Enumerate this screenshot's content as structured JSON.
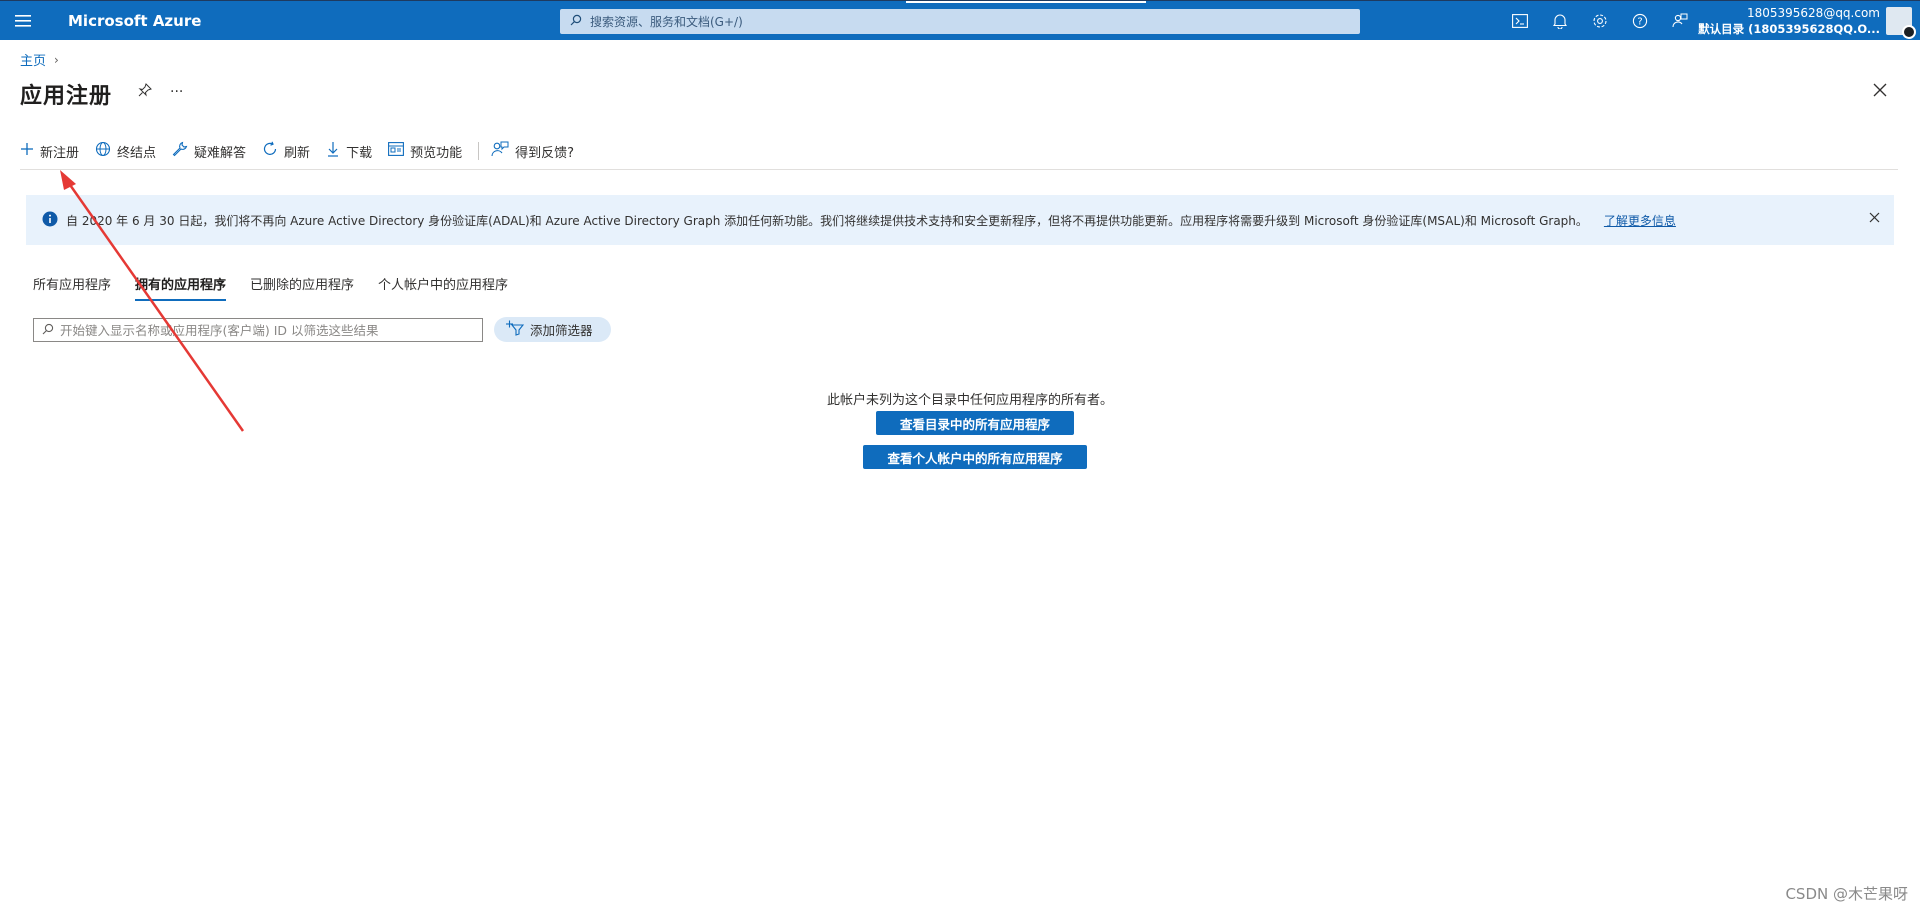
{
  "header": {
    "brand": "Microsoft Azure",
    "search_placeholder": "搜索资源、服务和文档(G+/)",
    "account_email": "1805395628@qq.com",
    "account_directory": "默认目录 (1805395628QQ.O...",
    "icons": [
      "cloud-shell-icon",
      "bell-icon",
      "gear-icon",
      "help-icon",
      "feedback-icon"
    ]
  },
  "breadcrumb": {
    "home": "主页",
    "separator": "›"
  },
  "page": {
    "title": "应用注册",
    "more": "···"
  },
  "toolbar": {
    "items": [
      {
        "label": "新注册",
        "icon": "plus-icon"
      },
      {
        "label": "终结点",
        "icon": "globe-icon"
      },
      {
        "label": "疑难解答",
        "icon": "wrench-icon"
      },
      {
        "label": "刷新",
        "icon": "refresh-icon"
      },
      {
        "label": "下载",
        "icon": "download-icon"
      },
      {
        "label": "预览功能",
        "icon": "preview-icon"
      }
    ],
    "feedback": "得到反馈?"
  },
  "banner": {
    "text": "自 2020 年 6 月 30 日起，我们将不再向 Azure Active Directory 身份验证库(ADAL)和 Azure Active Directory Graph 添加任何新功能。我们将继续提供技术支持和安全更新程序，但将不再提供功能更新。应用程序将需要升级到 Microsoft 身份验证库(MSAL)和 Microsoft Graph。",
    "link": "了解更多信息"
  },
  "tabs": [
    {
      "label": "所有应用程序",
      "active": false
    },
    {
      "label": "拥有的应用程序",
      "active": true
    },
    {
      "label": "已删除的应用程序",
      "active": false
    },
    {
      "label": "个人帐户中的应用程序",
      "active": false
    }
  ],
  "filter": {
    "placeholder": "开始键入显示名称或应用程序(客户端) ID 以筛选这些结果",
    "add_filter": "添加筛选器"
  },
  "empty_state": {
    "message": "此帐户未列为这个目录中任何应用程序的所有者。",
    "button_all": "查看目录中的所有应用程序",
    "button_personal": "查看个人帐户中的所有应用程序"
  },
  "watermark": "CSDN @木芒果呀",
  "colors": {
    "accent": "#0f6cbd",
    "banner_bg": "#e8f2fc",
    "annotation": "#e53935"
  }
}
